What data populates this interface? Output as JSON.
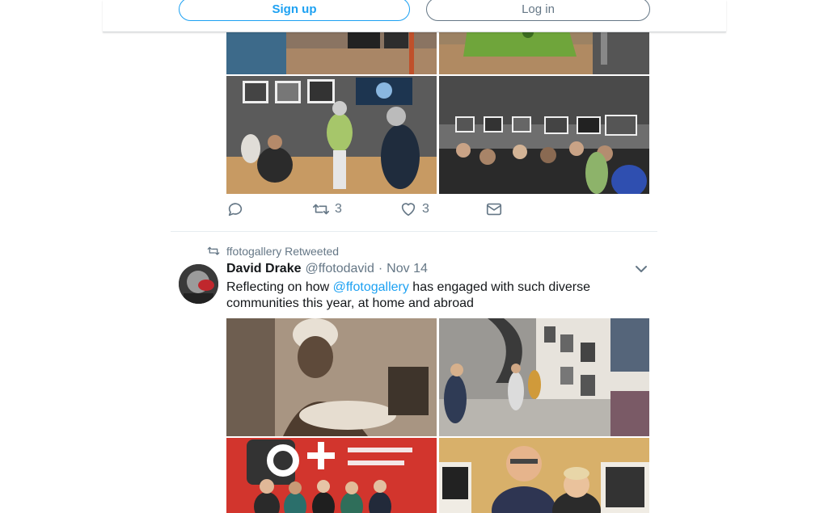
{
  "auth_bar": {
    "signup_label": "Sign up",
    "login_label": "Log in"
  },
  "tweet1": {
    "actions": {
      "reply_count": "",
      "retweet_count": "3",
      "like_count": "3"
    }
  },
  "tweet2": {
    "retweet_context": "ffotogallery Retweeted",
    "author_name": "David Drake",
    "author_handle": "@ffotodavid",
    "separator": "·",
    "date": "Nov 14",
    "text_before_mention": "Reflecting on how ",
    "mention": "@ffotogallery",
    "text_after_mention": " has engaged with such diverse communities this year, at home and abroad"
  },
  "colors": {
    "brand": "#1da1f2",
    "secondary_text": "#657786",
    "primary_text": "#14171a",
    "divider": "#e6ecf0"
  },
  "icons": [
    "reply-icon",
    "retweet-icon",
    "like-icon",
    "direct-message-icon",
    "retweet-context-icon",
    "chevron-down-icon"
  ]
}
